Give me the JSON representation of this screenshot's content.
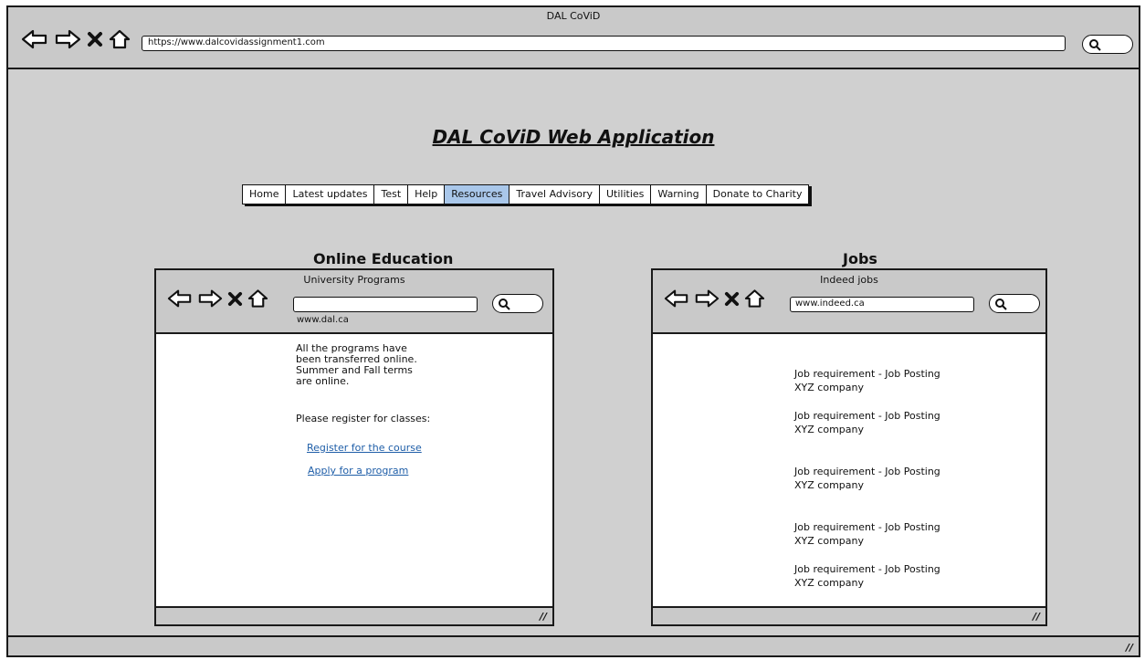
{
  "window": {
    "title": "DAL CoViD",
    "url": "https://www.dalcovidassignment1.com"
  },
  "app_title": "DAL CoViD Web Application",
  "menu": {
    "items": [
      {
        "label": "Home"
      },
      {
        "label": "Latest updates"
      },
      {
        "label": "Test"
      },
      {
        "label": "Help"
      },
      {
        "label": "Resources",
        "active": true
      },
      {
        "label": "Travel Advisory"
      },
      {
        "label": "Utilities"
      },
      {
        "label": "Warning"
      },
      {
        "label": "Donate to Charity"
      }
    ]
  },
  "education": {
    "heading": "Online Education",
    "window_title": "University Programs",
    "url_below": "www.dal.ca",
    "body_lines": [
      "All the programs have",
      "been transferred online.",
      "Summer and Fall terms",
      "are online."
    ],
    "prompt": "Please register for classes:",
    "links": [
      "Register for the course",
      "Apply for a program"
    ]
  },
  "jobs": {
    "heading": "Jobs",
    "window_title": "Indeed jobs",
    "url": "www.indeed.ca",
    "postings": [
      {
        "title": "Job requirement - Job Posting",
        "company": "XYZ company"
      },
      {
        "title": "Job requirement - Job Posting",
        "company": "XYZ company"
      },
      {
        "title": "Job requirement - Job Posting",
        "company": "XYZ company"
      },
      {
        "title": "Job requirement - Job Posting",
        "company": "XYZ company"
      },
      {
        "title": "Job requirement - Job Posting",
        "company": "XYZ company"
      }
    ]
  },
  "icons": [
    "back-arrow-icon",
    "forward-arrow-icon",
    "close-x-icon",
    "home-icon",
    "search-icon",
    "resize-grip-icon"
  ],
  "colors": {
    "active_tab": "#a9c7ea",
    "link": "#1f5ea8",
    "chrome": "#c9c9c9"
  }
}
